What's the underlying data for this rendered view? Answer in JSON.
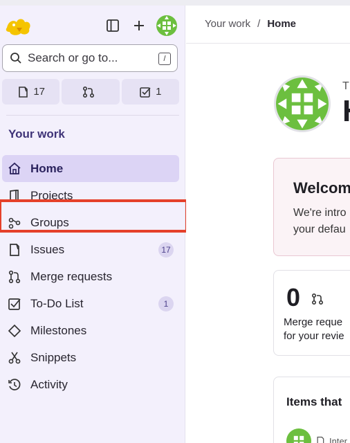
{
  "topbar": {
    "logo_icon": "tanuki-logo-icon",
    "sidebar_toggle_icon": "sidebar-toggle-icon",
    "new_icon": "plus-icon"
  },
  "search": {
    "placeholder": "Search or go to...",
    "shortcut": "/"
  },
  "counters": [
    {
      "icon": "issues-icon",
      "count": "17"
    },
    {
      "icon": "merge-request-icon",
      "count": ""
    },
    {
      "icon": "todo-icon",
      "count": "1"
    }
  ],
  "sidebar": {
    "section_title": "Your work",
    "items": [
      {
        "label": "Home",
        "icon": "home-icon",
        "badge": ""
      },
      {
        "label": "Projects",
        "icon": "project-icon",
        "badge": ""
      },
      {
        "label": "Groups",
        "icon": "group-icon",
        "badge": ""
      },
      {
        "label": "Issues",
        "icon": "issues-icon",
        "badge": "17"
      },
      {
        "label": "Merge requests",
        "icon": "merge-request-icon",
        "badge": ""
      },
      {
        "label": "To-Do List",
        "icon": "todo-icon",
        "badge": "1"
      },
      {
        "label": "Milestones",
        "icon": "milestone-icon",
        "badge": ""
      },
      {
        "label": "Snippets",
        "icon": "snippet-icon",
        "badge": ""
      },
      {
        "label": "Activity",
        "icon": "history-icon",
        "badge": ""
      }
    ],
    "active_item": "Home",
    "highlighted_item": "Groups"
  },
  "breadcrumb": {
    "parent": "Your work",
    "separator": "/",
    "current": "Home"
  },
  "main": {
    "title_cut": "T",
    "heading_cut": "H",
    "welcome": {
      "title": "Welcom",
      "line1": "We're intro",
      "line2": "your defau"
    },
    "mr_card": {
      "count": "0",
      "line1": "Merge reque",
      "line2": "for your revie"
    },
    "items_card": {
      "title": "Items that",
      "row_text": "Inter"
    }
  },
  "colors": {
    "sidebar_bg": "#f3f0fc",
    "active_bg": "#dcd4f5",
    "accent": "#3f3478",
    "highlight": "#e5402a",
    "avatar_green": "#6cbf3f"
  }
}
